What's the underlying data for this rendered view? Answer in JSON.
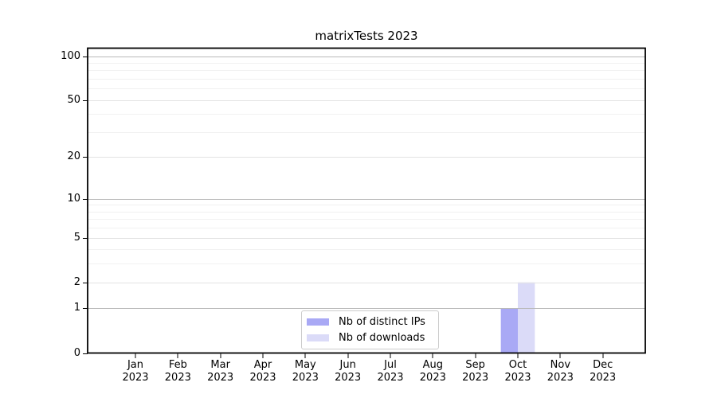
{
  "chart_data": {
    "type": "bar",
    "title": "matrixTests 2023",
    "categories": [
      "Jan",
      "Feb",
      "Mar",
      "Apr",
      "May",
      "Jun",
      "Jul",
      "Aug",
      "Sep",
      "Oct",
      "Nov",
      "Dec"
    ],
    "category_year_label": "2023",
    "series": [
      {
        "name": "Nb of distinct IPs",
        "color": "#a9a9f5",
        "values": [
          0,
          0,
          0,
          0,
          0,
          0,
          0,
          0,
          0,
          1,
          0,
          0
        ]
      },
      {
        "name": "Nb of downloads",
        "color": "#dbdbf8",
        "values": [
          0,
          0,
          0,
          0,
          0,
          0,
          0,
          0,
          0,
          2,
          0,
          0
        ]
      }
    ],
    "xlabel": "",
    "ylabel": "",
    "yscale": "log1p",
    "ylim": [
      0,
      114
    ],
    "yticks": [
      0,
      1,
      2,
      5,
      10,
      20,
      50,
      100
    ],
    "ytick_labels": [
      "0",
      "1",
      "2",
      "5",
      "10",
      "20",
      "50",
      "100"
    ],
    "yticks_emphasized": [
      1,
      10,
      100
    ],
    "yticks_minor": [
      3,
      4,
      6,
      7,
      8,
      9,
      30,
      40,
      60,
      70,
      80,
      90
    ],
    "grid": "on",
    "legend_position": "bottom-center-inside"
  },
  "colors": {
    "background": "#ffffff",
    "frame": "#000000",
    "gridline_emphasized": "#b9b9b9",
    "gridline_major": "#e3e3e3",
    "gridline_minor": "#f1f1f1",
    "legend_border": "#cccccc",
    "text": "#000000"
  }
}
